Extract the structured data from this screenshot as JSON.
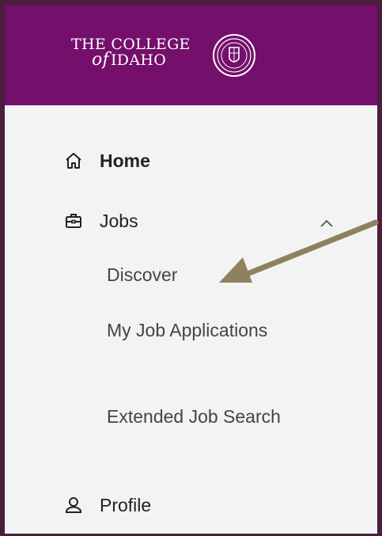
{
  "header": {
    "logo": {
      "line1": "THE COLLEGE",
      "line2_of": "of",
      "line2_name": "IDAHO"
    }
  },
  "nav": {
    "home": {
      "label": "Home",
      "icon": "home-icon"
    },
    "jobs": {
      "label": "Jobs",
      "icon": "briefcase-icon",
      "expanded": true
    },
    "jobs_sub": [
      {
        "label": "Discover"
      },
      {
        "label": "My Job Applications"
      },
      {
        "label": "Extended Job Search"
      }
    ],
    "profile": {
      "label": "Profile",
      "icon": "person-icon"
    }
  },
  "colors": {
    "header_bg": "#740f6c",
    "frame": "#4a1f3d",
    "panel_bg": "#f3f3f3",
    "arrow": "#8f8060"
  }
}
